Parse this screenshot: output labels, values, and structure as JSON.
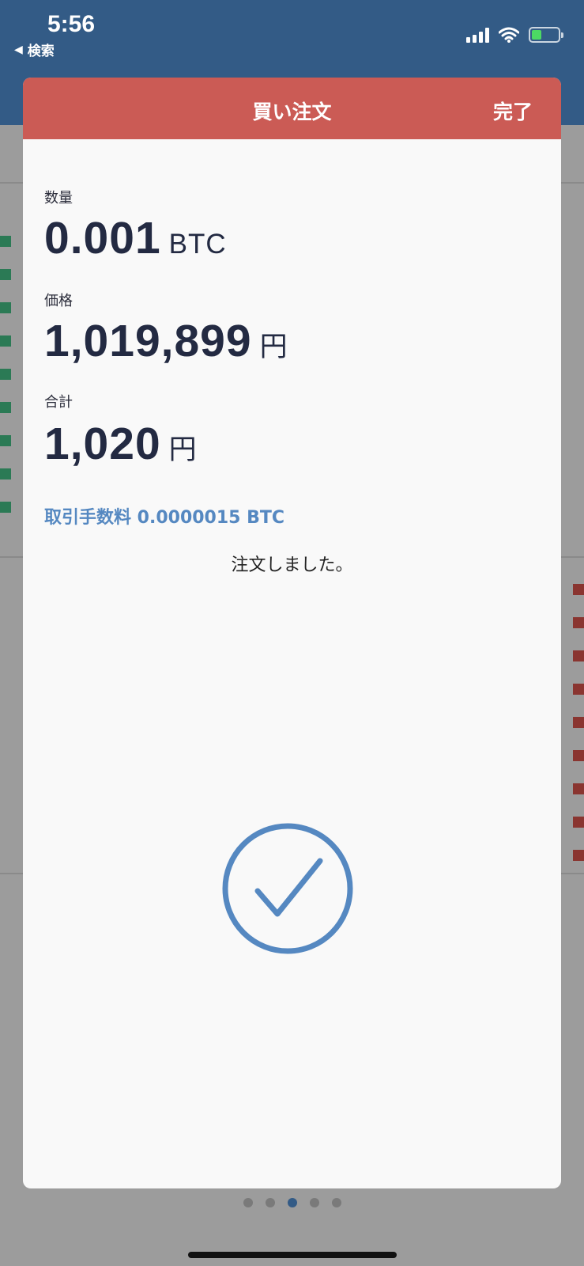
{
  "status_bar": {
    "time": "5:56",
    "back_label": "検索",
    "battery_color": "#4cd964"
  },
  "modal": {
    "title": "買い注文",
    "done_label": "完了",
    "quantity_label": "数量",
    "quantity_value": "0.001",
    "quantity_unit": "BTC",
    "price_label": "価格",
    "price_value": "1,019,899",
    "price_unit": "円",
    "total_label": "合計",
    "total_value": "1,020",
    "total_unit": "円",
    "fee_text": "取引手数料 0.0000015 BTC",
    "message": "注文しました。",
    "success_icon": "check-circle-icon"
  },
  "colors": {
    "header": "#cb5b55",
    "accent": "#5588c1",
    "text_dark": "#232a42"
  },
  "pager": {
    "page_count": 5,
    "active_index": 2
  }
}
